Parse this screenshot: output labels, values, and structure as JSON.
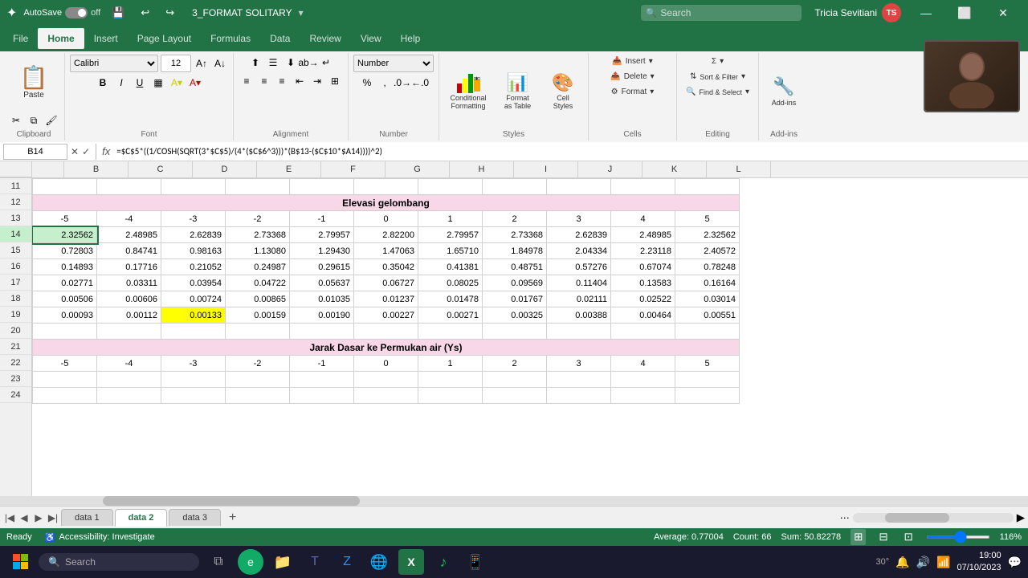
{
  "titlebar": {
    "app_icon": "X",
    "autosave_label": "AutoSave",
    "toggle_state": "off",
    "filename": "3_FORMAT SOLITARY",
    "search_placeholder": "Search",
    "user_name": "Tricia Sevitiani",
    "avatar_initials": "TS"
  },
  "ribbon": {
    "tabs": [
      "File",
      "Home",
      "Insert",
      "Page Layout",
      "Formulas",
      "Data",
      "Review",
      "View",
      "Help"
    ],
    "active_tab": "Home",
    "groups": {
      "clipboard": "Clipboard",
      "font": "Font",
      "alignment": "Alignment",
      "number": "Number",
      "styles": "Styles",
      "cells": "Cells",
      "editing": "Editing",
      "addins": "Add-ins"
    },
    "font_name": "Calibri",
    "font_size": "12",
    "number_format": "Number",
    "conditional_formatting": "Conditional\nFormatting",
    "format_as_table": "Format as\nTable",
    "cell_styles": "Cell\nStyles",
    "insert_label": "Insert",
    "delete_label": "Delete",
    "format_label": "Format",
    "sort_filter": "Sort &\nFilter",
    "find_select": "Find &\nSelect"
  },
  "formula_bar": {
    "cell_ref": "B14",
    "formula": "=$C$5*((1/COSH(SQRT(3*$C$5)/(4*($C$6^3)))*(B$13-($C$10*$A14))))^2)"
  },
  "columns": {
    "headers": [
      "B",
      "C",
      "D",
      "E",
      "F",
      "G",
      "H",
      "I",
      "J",
      "K",
      "L"
    ],
    "widths": [
      80,
      80,
      80,
      80,
      80,
      80,
      80,
      80,
      80,
      80,
      80
    ]
  },
  "rows": {
    "numbers": [
      11,
      12,
      13,
      14,
      15,
      16,
      17,
      18,
      19,
      20,
      21,
      22,
      23,
      24
    ]
  },
  "grid_data": {
    "row11": [
      "",
      "",
      "",
      "",
      "",
      "",
      "",
      "",
      "",
      "",
      ""
    ],
    "row12": [
      "Elevasi gelombang",
      "",
      "",
      "",
      "",
      "",
      "",
      "",
      "",
      "",
      ""
    ],
    "row13": [
      "-5",
      "-4",
      "-3",
      "-2",
      "-1",
      "0",
      "1",
      "2",
      "3",
      "4",
      "5"
    ],
    "row14": [
      "2.32562",
      "2.48985",
      "2.62839",
      "2.73368",
      "2.79957",
      "2.82200",
      "2.79957",
      "2.73368",
      "2.62839",
      "2.48985",
      "2.32562"
    ],
    "row15": [
      "0.72803",
      "0.84741",
      "0.98163",
      "1.13080",
      "1.29430",
      "1.47063",
      "1.65710",
      "1.84978",
      "2.04334",
      "2.23118",
      "2.40572"
    ],
    "row16": [
      "0.14893",
      "0.17716",
      "0.21052",
      "0.24987",
      "0.29615",
      "0.35042",
      "0.41381",
      "0.48751",
      "0.57276",
      "0.67074",
      "0.78248"
    ],
    "row17": [
      "0.02771",
      "0.03311",
      "0.03954",
      "0.04722",
      "0.05637",
      "0.06727",
      "0.08025",
      "0.09569",
      "0.11404",
      "0.13583",
      "0.16164"
    ],
    "row18": [
      "0.00506",
      "0.00606",
      "0.00724",
      "0.00865",
      "0.01035",
      "0.01237",
      "0.01478",
      "0.01767",
      "0.02111",
      "0.02522",
      "0.03014"
    ],
    "row19": [
      "0.00093",
      "0.00112",
      "0.00133",
      "0.00159",
      "0.00190",
      "0.00227",
      "0.00271",
      "0.00325",
      "0.00388",
      "0.00464",
      "0.00551"
    ],
    "row20": [
      "",
      "",
      "",
      "",
      "",
      "",
      "",
      "",
      "",
      "",
      ""
    ],
    "row21": [
      "Jarak Dasar ke Permukan air (Ys)",
      "",
      "",
      "",
      "",
      "",
      "",
      "",
      "",
      "",
      ""
    ],
    "row22": [
      "-5",
      "-4",
      "-3",
      "-2",
      "-1",
      "0",
      "1",
      "2",
      "3",
      "4",
      "5"
    ],
    "row23": [
      "",
      "",
      "",
      "",
      "",
      "",
      "",
      "",
      "",
      "",
      ""
    ],
    "row24": [
      "",
      "",
      "",
      "",
      "",
      "",
      "",
      "",
      "",
      "",
      ""
    ]
  },
  "sheet_tabs": {
    "tabs": [
      "data 1",
      "data 2",
      "data 3"
    ],
    "active": "data 2",
    "add_label": "+"
  },
  "status_bar": {
    "ready": "Ready",
    "accessibility": "Accessibility: Investigate",
    "average": "Average: 0.77004",
    "count": "Count: 66",
    "sum": "Sum: 50.82278",
    "zoom": "116%"
  },
  "taskbar": {
    "search_placeholder": "Search",
    "time": "19:00",
    "date": "07/10/2023",
    "temperature": "30°"
  },
  "webcam": {
    "visible": true
  }
}
